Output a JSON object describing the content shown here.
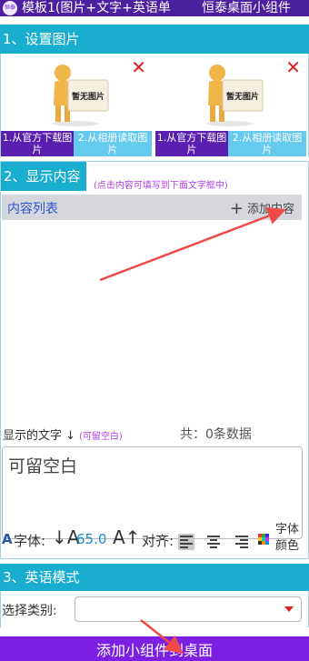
{
  "titlebar": {
    "icon_text": "恒泰",
    "title": "模板1(图片+文字+英语单",
    "app_name": "恒泰桌面小组件"
  },
  "section1": {
    "title": "1、设置图片",
    "cards": [
      {
        "placeholder_text": "暂无图片",
        "close_glyph": "✕",
        "download_label": "1.从官方下载图片",
        "album_label": "2.从相册读取图片"
      },
      {
        "placeholder_text": "暂无图片",
        "close_glyph": "✕",
        "download_label": "1.从官方下载图片",
        "album_label": "2.从相册读取图片"
      }
    ]
  },
  "section2": {
    "title": "2、显示内容",
    "hint": "(点击内容可填写到下面文字框中)",
    "list_title": "内容列表",
    "add_label": "添加内容",
    "display_label": "显示的文字 ↓",
    "display_hint": "(可留空白)",
    "count_text": "共：0条数据",
    "textarea_value": "可留空白",
    "font_label": "字体:",
    "font_size": "65.0",
    "align_label": "对齐:",
    "font_color_label": "字体颜色"
  },
  "section3": {
    "title": "3、英语模式",
    "category_label": "选择类别:",
    "category_value": ""
  },
  "bottom_button": {
    "label": "添加小组件到桌面"
  },
  "colors": {
    "titlebar": "#4b1f9e",
    "section_header": "#19aecf",
    "download_button": "#5a1fb0",
    "album_button": "#66c9ee",
    "bottom_button": "#7b20e3",
    "hint_text": "#b13fe6",
    "close_icon": "#e0201c",
    "annotation_arrow": "#ef4a4a"
  }
}
